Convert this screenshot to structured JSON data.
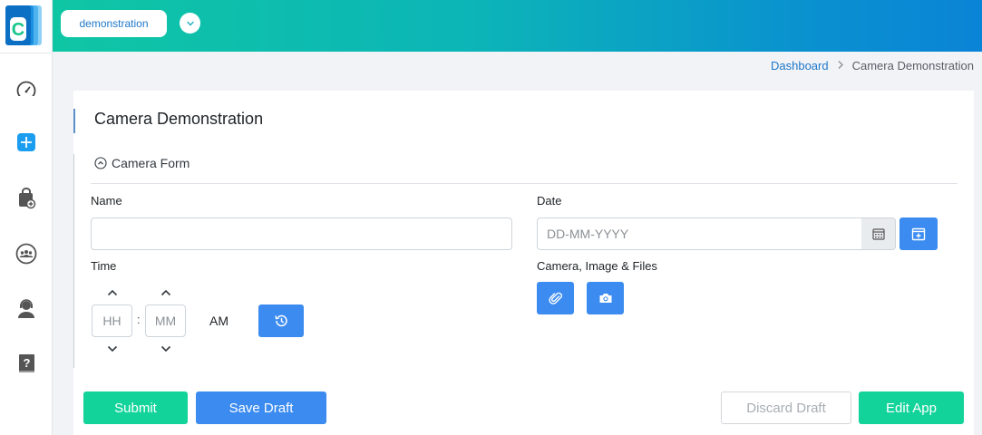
{
  "app": {
    "logo_letter": "C",
    "selected_app": "demonstration"
  },
  "sidebar": {
    "items": [
      {
        "name": "dashboard",
        "icon": "speedometer-icon"
      },
      {
        "name": "create",
        "icon": "plus-square-icon"
      },
      {
        "name": "add-bag",
        "icon": "bag-plus-icon"
      },
      {
        "name": "groups",
        "icon": "people-icon"
      },
      {
        "name": "support",
        "icon": "headset-user-icon"
      },
      {
        "name": "help",
        "icon": "help-book-icon"
      }
    ]
  },
  "breadcrumb": {
    "items": [
      "Dashboard",
      "Camera Demonstration"
    ]
  },
  "page": {
    "title": "Camera Demonstration"
  },
  "form": {
    "section_title": "Camera Form",
    "name_label": "Name",
    "name_value": "",
    "date_label": "Date",
    "date_placeholder": "DD-MM-YYYY",
    "time_label": "Time",
    "hour_placeholder": "HH",
    "minute_placeholder": "MM",
    "time_separator": ":",
    "meridian": "AM",
    "attachments_label": "Camera, Image & Files"
  },
  "actions": {
    "submit": "Submit",
    "save_draft": "Save Draft",
    "discard_draft": "Discard Draft",
    "edit_app": "Edit App"
  },
  "colors": {
    "accent_blue": "#3b8bf0",
    "accent_green": "#12d39a",
    "header_start": "#0fc6a4",
    "header_end": "#0a84d6"
  }
}
